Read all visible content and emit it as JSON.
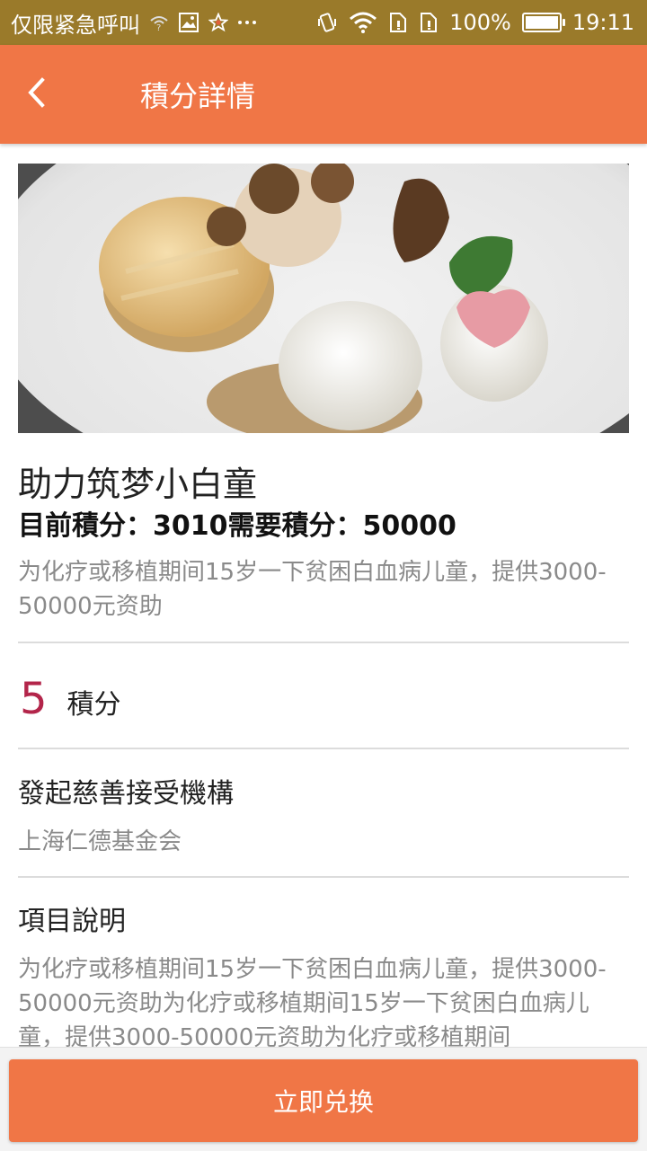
{
  "status_bar": {
    "carrier": "仅限紧急呼叫",
    "battery": "100%",
    "time": "19:11",
    "battery_level": 1.0,
    "icons": [
      "signal-icon",
      "image-icon",
      "star-icon",
      "more-icon",
      "vibrate-icon",
      "wifi-icon",
      "sim1-icon",
      "sim2-icon",
      "battery-icon"
    ]
  },
  "appbar": {
    "title": "積分詳情",
    "back_icon": "chevron-left-icon"
  },
  "detail": {
    "title": "助力筑梦小白童",
    "points_line": "目前積分：3010需要積分：50000",
    "description": "为化疗或移植期间15岁一下贫困白血病儿童，提供3000-50000元资助",
    "cost_value": "5",
    "cost_unit": "積分",
    "org_title": "發起慈善接受機構",
    "org_name": "上海仁德基金会",
    "project_title": "項目說明",
    "project_desc": "为化疗或移植期间15岁一下贫困白血病儿童，提供3000-50000元资助为化疗或移植期间15岁一下贫困白血病儿童，提供3000-50000元资助为化疗或移植期间"
  },
  "actions": {
    "redeem_label": "立即兑换"
  },
  "colors": {
    "accent": "#f07646",
    "status_bar": "#9a7a2a",
    "cost_number": "#b3254a",
    "secondary_text": "#8a8a8a"
  }
}
